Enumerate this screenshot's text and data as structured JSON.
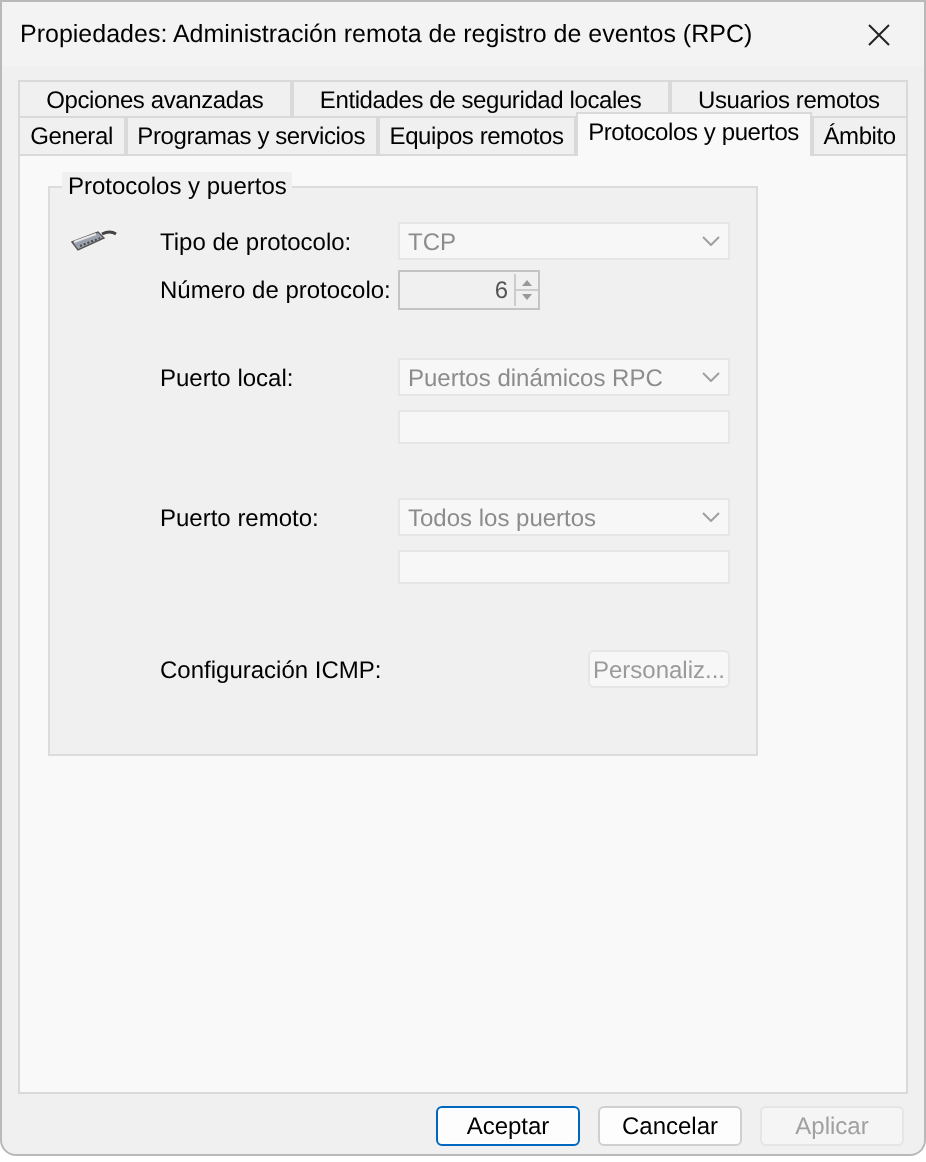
{
  "window": {
    "title": "Propiedades: Administración remota de registro de eventos (RPC)"
  },
  "tab_rows": [
    [
      {
        "label": "Opciones avanzadas",
        "selected": false
      },
      {
        "label": "Entidades de seguridad locales",
        "selected": false
      },
      {
        "label": "Usuarios remotos",
        "selected": false
      }
    ],
    [
      {
        "label": "General",
        "selected": false
      },
      {
        "label": "Programas y servicios",
        "selected": false
      },
      {
        "label": "Equipos remotos",
        "selected": false
      },
      {
        "label": "Protocolos y puertos",
        "selected": true
      },
      {
        "label": "Ámbito",
        "selected": false
      }
    ]
  ],
  "group": {
    "title": "Protocolos y puertos",
    "fields": [
      {
        "kind": "combo",
        "label": "Tipo de protocolo:",
        "value": "TCP",
        "disabled": true
      },
      {
        "kind": "spin",
        "label": "Número de protocolo:",
        "value": "6",
        "disabled": true
      },
      {
        "kind": "combo",
        "label": "Puerto local:",
        "value": "Puertos dinámicos RPC",
        "disabled": true
      },
      {
        "kind": "textbox",
        "disabled": true
      },
      {
        "kind": "combo",
        "label": "Puerto remoto:",
        "value": "Todos los puertos",
        "disabled": true
      },
      {
        "kind": "textbox",
        "disabled": true
      },
      {
        "kind": "button",
        "label": "Configuración ICMP:",
        "value": "Personaliz...",
        "disabled": true
      }
    ]
  },
  "buttons": [
    {
      "label": "Aceptar",
      "default": true,
      "disabled": false
    },
    {
      "label": "Cancelar",
      "default": false,
      "disabled": false
    },
    {
      "label": "Aplicar",
      "default": false,
      "disabled": true
    }
  ]
}
